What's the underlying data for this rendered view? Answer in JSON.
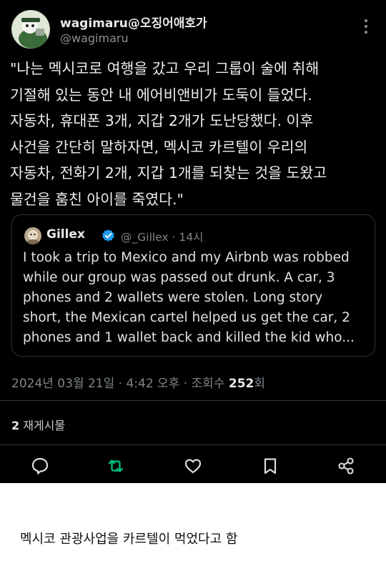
{
  "post": {
    "display_name": "wagimaru@오징어애호가",
    "handle": "@wagimaru",
    "body_lines": [
      "\"나는 멕시코로 여행을 갔고 우리 그룹이 술에 취해",
      "기절해 있는 동안 내 에어비앤비가 도둑이 들었다.",
      "자동차, 휴대폰 3개, 지갑 2개가 도난당했다. 이후",
      "사건을 간단히 말하자면, 멕시코 카르텔이 우리의",
      "자동차, 전화기 2개, 지갑 1개를 되찾는 것을 도왔고",
      "물건을 훔친 아이를 죽였다.\""
    ],
    "quoted": {
      "name": "Gillex",
      "meta": "@_Gillex · 14시",
      "text_lines": [
        "I took a trip to Mexico and my Airbnb was robbed",
        "while our group was passed out drunk. A car, 3",
        "phones and 2 wallets were stolen. Long story",
        "short, the Mexican cartel helped us get the car, 2",
        "phones and 1 wallet back and killed the kid who..."
      ]
    },
    "timestamp": "2024년 03월 21일 · 4:42 오후 · 조회수 ",
    "views": "252",
    "views_suffix": "회",
    "reposts_count": "2",
    "reposts_label": " 재게시물",
    "icons": {
      "more": "more-vertical-icon",
      "reply": "reply-icon",
      "repost": "repost-icon",
      "like": "like-icon",
      "bookmark": "bookmark-icon",
      "share": "share-icon",
      "verified": "verified-badge-icon"
    },
    "colors": {
      "background": "#000000",
      "text": "#e7e9ea",
      "muted": "#7e868c",
      "accent_repost": "#00ba7c",
      "verified": "#1d9bf0"
    }
  },
  "caption": "멕시코 관광사업을 카르텔이 먹었다고 함"
}
